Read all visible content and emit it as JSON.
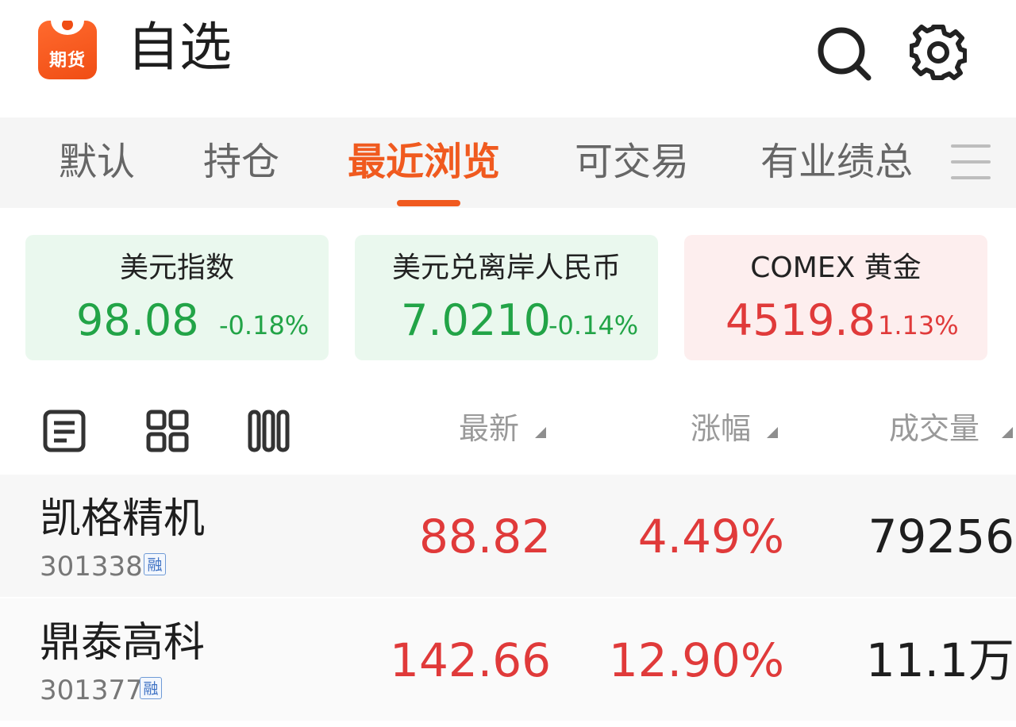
{
  "app": {
    "logo_text": "期货",
    "title": "自选"
  },
  "header": {
    "search_icon": "search-icon",
    "settings_icon": "gear-icon"
  },
  "tabs": [
    {
      "label": "默认",
      "active": false
    },
    {
      "label": "持仓",
      "active": false
    },
    {
      "label": "最近浏览",
      "active": true
    },
    {
      "label": "可交易",
      "active": false
    },
    {
      "label": "有业绩总",
      "active": false
    }
  ],
  "tab_menu_icon": "menu-icon",
  "indices": [
    {
      "title": "美元指数",
      "price": "98.08",
      "change": "-0.18%",
      "trend": "down"
    },
    {
      "title": "美元兑离岸人民币",
      "price": "7.0210",
      "change": "-0.14%",
      "trend": "down"
    },
    {
      "title": "COMEX 黄金",
      "price": "4519.8",
      "change": "1.13%",
      "trend": "up"
    }
  ],
  "list_header": {
    "view_icons": [
      "list-view-icon",
      "grid-view-icon",
      "column-view-icon"
    ],
    "columns": [
      "最新",
      "涨幅",
      "成交量"
    ]
  },
  "stocks": [
    {
      "name": "凯格精机",
      "code": "301338",
      "badge": "融",
      "price": "88.82",
      "change_pct": "4.49%",
      "volume": "79256"
    },
    {
      "name": "鼎泰高科",
      "code": "301377",
      "badge": "融",
      "price": "142.66",
      "change_pct": "12.90%",
      "volume": "11.1万"
    }
  ],
  "colors": {
    "accent": "#f05a1f",
    "up": "#e03a3a",
    "down": "#22a447",
    "up_bg": "#fdeeee",
    "down_bg": "#eaf8ee"
  }
}
